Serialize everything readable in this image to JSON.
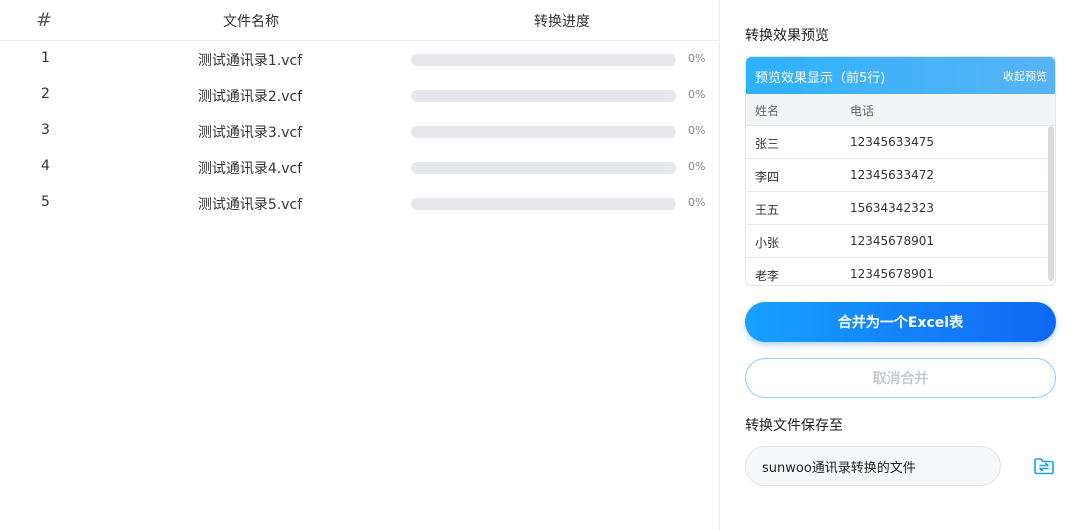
{
  "file_table": {
    "headers": {
      "index": "#",
      "name": "文件名称",
      "progress": "转换进度"
    },
    "rows": [
      {
        "index": "1",
        "name": "测试通讯录1.vcf",
        "progress": 0,
        "progress_label": "0%"
      },
      {
        "index": "2",
        "name": "测试通讯录2.vcf",
        "progress": 0,
        "progress_label": "0%"
      },
      {
        "index": "3",
        "name": "测试通讯录3.vcf",
        "progress": 0,
        "progress_label": "0%"
      },
      {
        "index": "4",
        "name": "测试通讯录4.vcf",
        "progress": 0,
        "progress_label": "0%"
      },
      {
        "index": "5",
        "name": "测试通讯录5.vcf",
        "progress": 0,
        "progress_label": "0%"
      }
    ]
  },
  "preview": {
    "section_title": "转换效果预览",
    "header_title": "预览效果显示（前5行)",
    "collapse_label": "收起预览",
    "columns": [
      "姓名",
      "电话"
    ],
    "rows": [
      {
        "name": "张三",
        "phone": "12345633475"
      },
      {
        "name": "李四",
        "phone": "12345633472"
      },
      {
        "name": "王五",
        "phone": "15634342323"
      },
      {
        "name": "小张",
        "phone": "12345678901"
      },
      {
        "name": "老李",
        "phone": "12345678901"
      }
    ]
  },
  "actions": {
    "merge_label": "合并为一个Excel表",
    "cancel_merge_label": "取消合并"
  },
  "save": {
    "section_title": "转换文件保存至",
    "path_value": "sunwoo通讯录转换的文件",
    "folder_icon": "folder-switch-icon"
  },
  "colors": {
    "accent": "#1e90ff",
    "button_gradient_start": "#17a1ff",
    "button_gradient_end": "#0f67f4",
    "preview_header": "#2fb1ff"
  }
}
